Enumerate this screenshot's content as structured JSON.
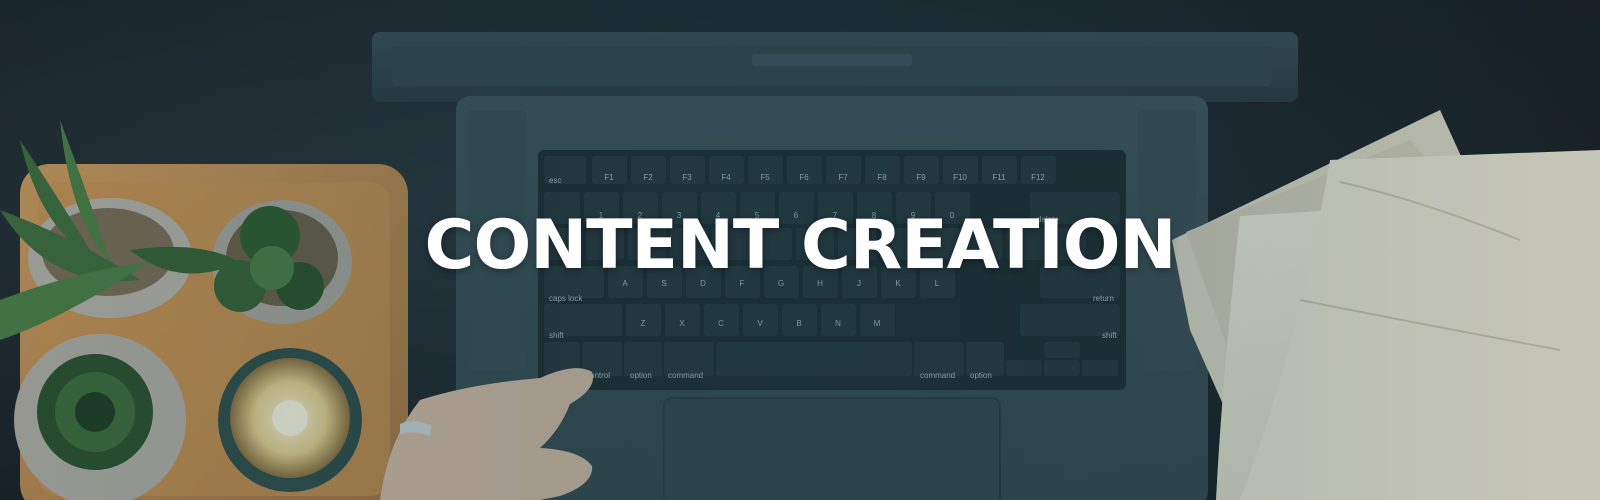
{
  "banner": {
    "headline": "CONTENT CREATION"
  },
  "keyboard": {
    "labels": {
      "esc": "esc",
      "delete": "delete",
      "caps_lock": "caps lock",
      "return": "return",
      "shift_left": "shift",
      "shift_right": "shift",
      "control": "control",
      "option_left": "option",
      "command_left": "command",
      "command_right": "command",
      "option_right": "option"
    },
    "function_keys": [
      "F1",
      "F2",
      "F3",
      "F4",
      "F5",
      "F6",
      "F7",
      "F8",
      "F9",
      "F10",
      "F11",
      "F12"
    ],
    "number_row": [
      "1",
      "2",
      "3",
      "4",
      "5",
      "6",
      "7",
      "8",
      "9",
      "0"
    ],
    "home_row": [
      "A",
      "S",
      "D",
      "F",
      "G",
      "H",
      "J",
      "K",
      "L"
    ],
    "bottom_row": [
      "Z",
      "X",
      "C",
      "V",
      "B",
      "N",
      "M"
    ]
  },
  "colors": {
    "overlay_tint": "#1f5a66",
    "headline": "#ffffff",
    "tray": "#c48a4f",
    "pages": "#e8e2d2"
  }
}
